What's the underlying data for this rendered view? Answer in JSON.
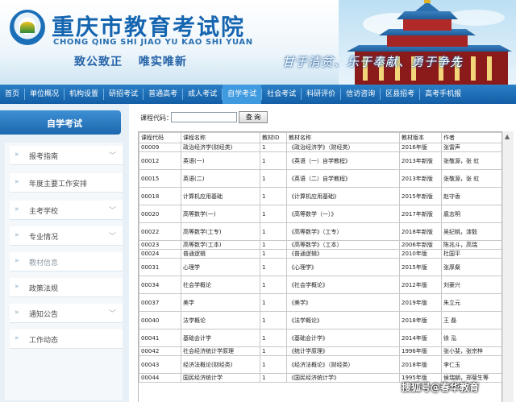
{
  "header": {
    "title": "重庆市教育考试院",
    "pinyin": "CHONG QING SHI JIAO YU KAO SHI YUAN",
    "slogan_left": "致公致正 唯实唯新",
    "slogan_right": "甘于清贫、乐于奉献、勇于争先"
  },
  "nav": {
    "items": [
      "首页",
      "单位概况",
      "机构设置",
      "研招考试",
      "普通高考",
      "成人考试",
      "自学考试",
      "社会考试",
      "科研评价",
      "信访咨询",
      "区县招考",
      "高考手机报"
    ],
    "active": "自学考试"
  },
  "sidebar": {
    "heading": "自学考试",
    "items": [
      {
        "label": "报考指南"
      },
      {
        "label": "年度主要工作安排"
      },
      {
        "label": "主考学校"
      },
      {
        "label": "专业情况"
      },
      {
        "label": "教材信息"
      },
      {
        "label": "政策法规"
      },
      {
        "label": "通知公告"
      },
      {
        "label": "工作动态"
      }
    ]
  },
  "search": {
    "label": "课程代码：",
    "value": "",
    "button": "查 询"
  },
  "table": {
    "headers": [
      "课程代码",
      "课程名称",
      "教材ID",
      "教材名称",
      "教材版本",
      "作者"
    ],
    "rows": [
      {
        "c": "00009",
        "n": "政治经济学(财经类)",
        "id": "1",
        "b": "《政治经济学》（财经类）",
        "v": "2016年版",
        "a": "张雷声"
      },
      {
        "c": "00012",
        "n": "英语(一)",
        "id": "1",
        "b": "《英语（一）自学教程》",
        "v": "2013年新版",
        "a": "张敬源，张 虹"
      },
      {
        "c": "00015",
        "n": "英语(二)",
        "id": "1",
        "b": "《英语（二）自学教程》",
        "v": "2013年新版",
        "a": "张敬源，张 虹"
      },
      {
        "c": "00018",
        "n": "计算机应用基础",
        "id": "1",
        "b": "《计算机应用基础》",
        "v": "2015年新版",
        "a": "赵守香"
      },
      {
        "c": "00020",
        "n": "高等数学(一)",
        "id": "1",
        "b": "《高等数学（一）》",
        "v": "2017年新版",
        "a": "扈志明"
      },
      {
        "c": "00022",
        "n": "高等数学(工专)",
        "id": "1",
        "b": "《高等数学》（工专）",
        "v": "2018年新版",
        "a": "吴纪桃，漆毅"
      },
      {
        "c": "00023",
        "n": "高等数学(工本)",
        "id": "1",
        "b": "《高等数学》（工本）",
        "v": "2006年新版",
        "a": "陈兆斗，高瑞"
      },
      {
        "c": "00024",
        "n": "普通逻辑",
        "id": "1",
        "b": "《普通逻辑》",
        "v": "2010年版",
        "a": "杜国平"
      },
      {
        "c": "00031",
        "n": "心理学",
        "id": "1",
        "b": "《心理学》",
        "v": "2015年版",
        "a": "张厚粲"
      },
      {
        "c": "00034",
        "n": "社会学概论",
        "id": "1",
        "b": "《社会学概论》",
        "v": "2012年版",
        "a": "刘豪兴"
      },
      {
        "c": "00037",
        "n": "美学",
        "id": "1",
        "b": "《美学》",
        "v": "2019年版",
        "a": "朱立元"
      },
      {
        "c": "00040",
        "n": "法学概论",
        "id": "1",
        "b": "《法学概论》",
        "v": "2018年版",
        "a": "王 磊"
      },
      {
        "c": "00041",
        "n": "基础会计学",
        "id": "1",
        "b": "《基础会计学》",
        "v": "2014年版",
        "a": "徐 泓"
      },
      {
        "c": "00042",
        "n": "社会经济统计学原理",
        "id": "1",
        "b": "《统计学原理》",
        "v": "1996年版",
        "a": "张小斐，张宗梓"
      },
      {
        "c": "00043",
        "n": "经济法概论(财经类)",
        "id": "1",
        "b": "《经济法概论》（财经类）",
        "v": "2018年版",
        "a": "李仁玉"
      },
      {
        "c": "00044",
        "n": "国民经济统计学",
        "id": "1",
        "b": "《国民经济统计学》",
        "v": "1995年版",
        "a": "侯瑞朝，郑菊生等"
      }
    ],
    "row_height": [
      "short",
      "tall",
      "tall",
      "tall",
      "tall",
      "tall",
      "short",
      "short",
      "tall",
      "tall",
      "tall",
      "tall",
      "tall",
      "short",
      "tall",
      "short"
    ]
  },
  "watermark": "搜狐号@春华教育"
}
